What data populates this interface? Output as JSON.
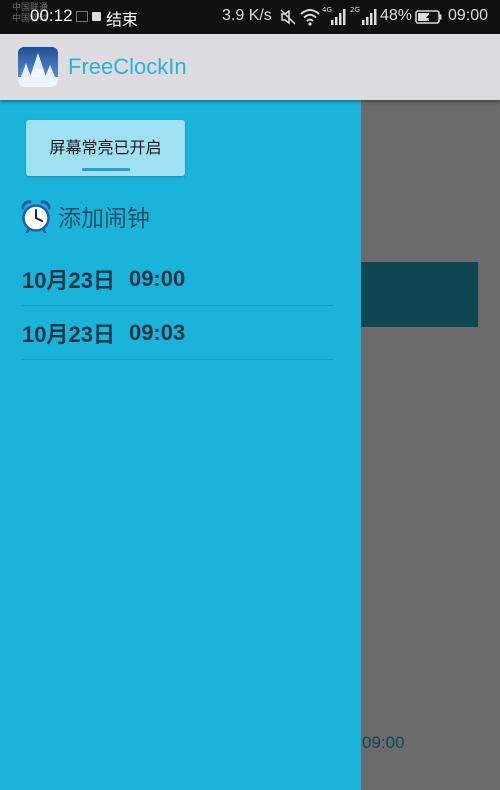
{
  "status_bar": {
    "carrier_1": "中国联通",
    "carrier_2": "中国移动",
    "left_time": "00:12",
    "activity_label": "结束",
    "net_speed": "3.9 K/s",
    "lte_label": "4G",
    "net2_label": "2G",
    "battery_percent": "48%",
    "right_time": "09:00"
  },
  "app_bar": {
    "title": "FreeClockIn",
    "logo_icon": "snowy-tree-app-icon"
  },
  "drawer": {
    "screen_button_label": "屏幕常亮已开启",
    "add_alarm_icon": "alarm-clock-icon",
    "add_alarm_label": "添加闹钟",
    "alarms": [
      {
        "date": "10月23日",
        "time": "09:00"
      },
      {
        "date": "10月23日",
        "time": "09:03"
      }
    ]
  },
  "background": {
    "time_text": "09:00"
  },
  "colors": {
    "drawer": "#1ab3da",
    "app_bar": "#dcdbe0",
    "title": "#28b4d8",
    "scrim": "#6b6b6b",
    "dark_teal": "#0e4654"
  }
}
